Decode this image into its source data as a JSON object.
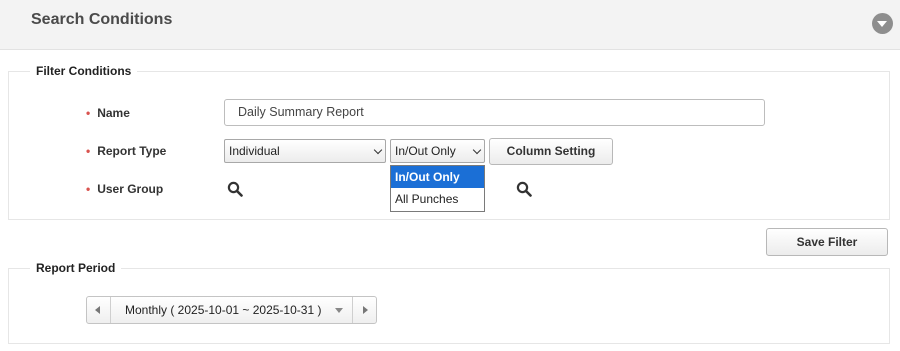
{
  "header": {
    "title": "Search Conditions",
    "collapse_icon": "chevron-down-circle-icon"
  },
  "filter": {
    "legend": "Filter Conditions",
    "required_mark": "•",
    "name_label": "Name",
    "name_value": "Daily Summary Report",
    "report_type_label": "Report Type",
    "report_type_value": "Individual",
    "punch_value": "In/Out Only",
    "punch_options": [
      "In/Out Only",
      "All Punches"
    ],
    "column_setting_label": "Column Setting",
    "user_group_label": "User Group",
    "search_icon": "magnifier-icon"
  },
  "save_filter_label": "Save Filter",
  "period": {
    "legend": "Report Period",
    "value": "Monthly ( 2025-10-01 ~ 2025-10-31 )"
  },
  "colors": {
    "accent": "#1b6fd6",
    "required": "#d9534f"
  }
}
